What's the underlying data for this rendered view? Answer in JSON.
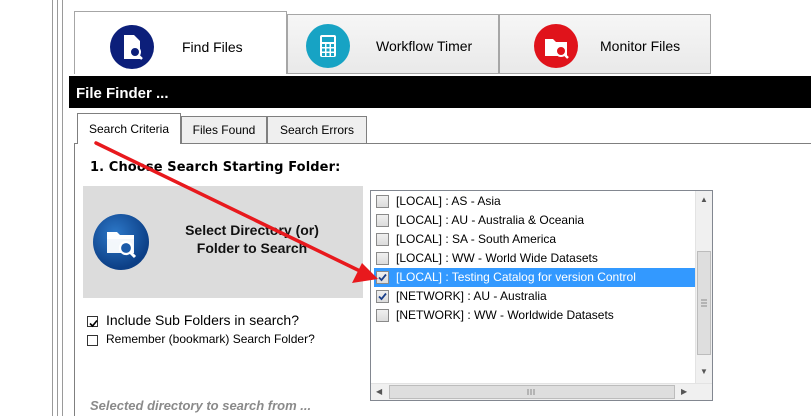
{
  "top_tabs": [
    {
      "label": "Find Files",
      "icon": "find-files-icon",
      "color": "#0c1f7a",
      "active": true
    },
    {
      "label": "Workflow Timer",
      "icon": "calculator-icon",
      "color": "#17a3c4",
      "active": false
    },
    {
      "label": "Monitor Files",
      "icon": "monitor-files-icon",
      "color": "#e0131b",
      "active": false
    }
  ],
  "panel_title": "File Finder ...",
  "sub_tabs": [
    {
      "label": "Search Criteria",
      "active": true
    },
    {
      "label": "Files Found",
      "active": false
    },
    {
      "label": "Search Errors",
      "active": false
    }
  ],
  "step_title": "1. Choose Search Starting Folder:",
  "select_button": {
    "label": "Select Directory (or)\nFolder to Search",
    "icon": "folder-search-icon"
  },
  "options": {
    "include_sub": {
      "label": "Include Sub Folders in search?",
      "checked": true
    },
    "remember": {
      "label": "Remember (bookmark) Search Folder?",
      "checked": false
    }
  },
  "folder_list": [
    {
      "label": "[LOCAL] : AS - Asia",
      "checked": false,
      "selected": false
    },
    {
      "label": "[LOCAL] : AU - Australia & Oceania",
      "checked": false,
      "selected": false
    },
    {
      "label": "[LOCAL] : SA - South America",
      "checked": false,
      "selected": false
    },
    {
      "label": "[LOCAL] : WW - World Wide Datasets",
      "checked": false,
      "selected": false
    },
    {
      "label": "[LOCAL] : Testing Catalog for version Control",
      "checked": true,
      "selected": true
    },
    {
      "label": "[NETWORK] : AU - Australia",
      "checked": true,
      "selected": false
    },
    {
      "label": "[NETWORK] : WW - Worldwide Datasets",
      "checked": false,
      "selected": false
    }
  ],
  "selected_dir_label": "Selected directory to search from ...",
  "colors": {
    "accent_selection": "#3399ff",
    "annotation_arrow": "#e8191d"
  }
}
